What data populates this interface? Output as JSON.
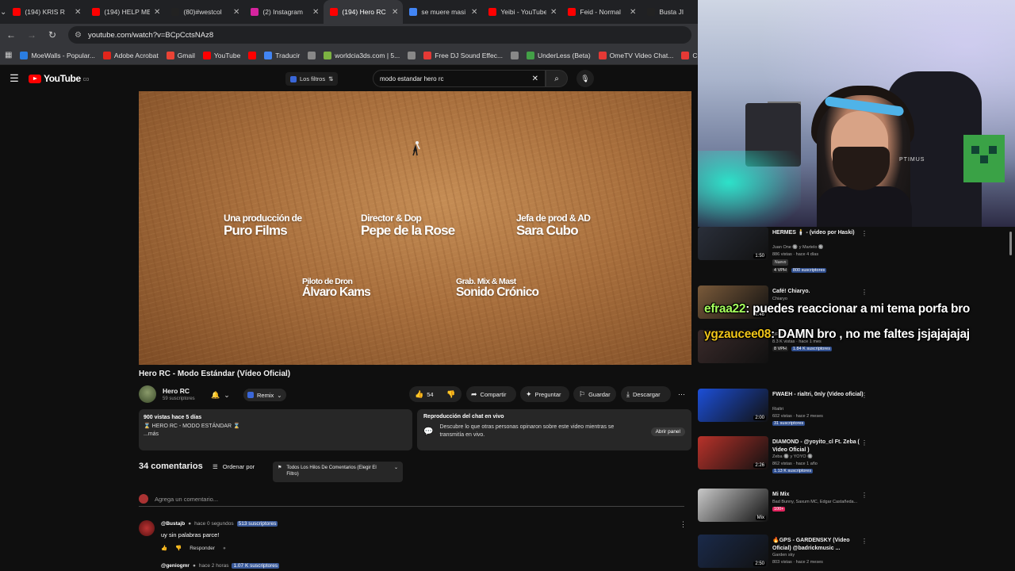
{
  "browser": {
    "tabs": [
      {
        "title": "(194) KRIS R",
        "color": "#ff0000",
        "active": false
      },
      {
        "title": "(194) HELP ME",
        "color": "#ff0000",
        "active": false
      },
      {
        "title": "(80)#westcol",
        "color": "#222222",
        "active": false
      },
      {
        "title": "(2) Instagram",
        "color": "#d6249f",
        "active": false
      },
      {
        "title": "(194) Hero RC",
        "color": "#ff0000",
        "active": true
      },
      {
        "title": "se muere masi",
        "color": "#4285f4",
        "active": false
      },
      {
        "title": "Yeibi - YouTube",
        "color": "#ff0000",
        "active": false
      },
      {
        "title": "Feid - Normal",
        "color": "#ff0000",
        "active": false
      },
      {
        "title": "Busta JI",
        "color": "#222222",
        "active": false
      }
    ],
    "url": "youtube.com/watch?v=BCpCctsNAz8",
    "bookmarks": [
      {
        "label": "MoeWalls - Popular...",
        "color": "#2a7de1"
      },
      {
        "label": "Adobe Acrobat",
        "color": "#e1251b"
      },
      {
        "label": "Gmail",
        "color": "#ea4335"
      },
      {
        "label": "YouTube",
        "color": "#ff0000"
      },
      {
        "label": "",
        "color": "#ff0000"
      },
      {
        "label": "Traducir",
        "color": "#4285f4"
      },
      {
        "label": "",
        "color": "#888888"
      },
      {
        "label": "worldcia3ds.com | 5...",
        "color": "#7cb342"
      },
      {
        "label": "",
        "color": "#888888"
      },
      {
        "label": "Free DJ Sound Effec...",
        "color": "#e53935"
      },
      {
        "label": "",
        "color": "#888888"
      },
      {
        "label": "UnderLess (Beta)",
        "color": "#43a047"
      },
      {
        "label": "OmeTV Video Chat...",
        "color": "#e53935"
      },
      {
        "label": "Ch",
        "color": "#e53935"
      }
    ]
  },
  "youtube": {
    "logo": "YouTube",
    "logo_region": "CO",
    "filters_label": "Los filtros",
    "search_query": "modo estandar hero rc"
  },
  "video": {
    "credits": [
      {
        "role": "Una producción de",
        "name": "Puro Films"
      },
      {
        "role": "Director & Dop",
        "name": "Pepe de la Rose"
      },
      {
        "role": "Jefa de prod & AD",
        "name": "Sara Cubo"
      },
      {
        "role": "Piloto de Dron",
        "name": "Álvaro Kams"
      },
      {
        "role": "Grab. Mix & Mast",
        "name": "Sonido Crónico"
      }
    ],
    "title": "Hero RC - Modo Estándar (Vídeo Oficial)",
    "channel": "Hero RC",
    "subscribers": "59 suscriptores",
    "remix": "Remix",
    "likes": "54",
    "share": "Compartir",
    "ask": "Preguntar",
    "save": "Guardar",
    "download": "Descargar"
  },
  "description": {
    "stats": "900 vistas  hace 5 días",
    "line": "⌛ HERO RC - MODO ESTÁNDAR ⌛",
    "more": "...más"
  },
  "chat_replay": {
    "title": "Reproducción del chat en vivo",
    "text": "Descubre lo que otras personas opinaron sobre este video mientras se transmitía en vivo.",
    "open": "Abrir panel"
  },
  "comments": {
    "count": "34 comentarios",
    "sort": "Ordenar por",
    "thread_filter": "Todos Los Hilos De Comentarios (Elegir El Filtro)",
    "add_placeholder": "Agrega un comentario...",
    "items": [
      {
        "user": "@Bustajb",
        "time": "hace 0 segundos",
        "subs": "513 suscriptores",
        "text": "uy sin palabras parce!",
        "reply": "Responder"
      },
      {
        "user": "@geniogmr",
        "time": "hace 2 horas",
        "subs": "1.07 K suscriptores"
      }
    ]
  },
  "recommendations": [
    {
      "title": "HERMES 🕯️ - (video por Haski)",
      "channel": "Juan One 🔘 y Martelo 🔘",
      "views": "886 vistas · hace 4 días",
      "tag": "Nuevo",
      "subs": "800 suscriptores",
      "extra": "4 VPH",
      "duration": "1:50",
      "thumb": "#2a2f3a"
    },
    {
      "title": "Café! Chiaryo.",
      "channel": "Chiaryo",
      "views": "",
      "tag": "",
      "subs": "",
      "extra": "",
      "duration": "2:46",
      "thumb": "#7a5a3a"
    },
    {
      "title": "",
      "channel": "OFICIAL)",
      "views": "8.3 K vistas · hace 1 mes",
      "tag": "",
      "subs": "1.84 K suscriptores",
      "extra": "8 VPH",
      "duration": "",
      "thumb": "#3a2a2a"
    },
    {
      "title": "FWAEH - rialtri, 0nly (Video oficial)",
      "channel": "Rialtri",
      "views": "602 vistas · hace 2 meses",
      "tag": "",
      "subs": "31 suscriptores",
      "extra": "",
      "duration": "2:00",
      "thumb": "#1c4fd8"
    },
    {
      "title": "DIAMOND - @yoyito_cl  Ft. Zeba ( Video Oficial )",
      "channel": "Zeba 🔘 y YOYO 🔘",
      "views": "862 vistas · hace 1 año",
      "tag": "",
      "subs": "1.13 K suscriptores",
      "extra": "",
      "duration": "2:26",
      "thumb": "#b8322a"
    },
    {
      "title": "Mi Mix",
      "channel": "Bad Bunny, Saxum MC, Edgar Castañeda...",
      "views": "",
      "tag": "",
      "subs": "",
      "extra": "100+",
      "duration": "Mix",
      "thumb": "#c9c9c9"
    },
    {
      "title": "🔥GPS - GARDENSKY (Video Oficial) @badrickmusic ...",
      "channel": "Garden sky",
      "views": "803 vistas · hace 2 meses",
      "tag": "",
      "subs": "",
      "extra": "",
      "duration": "2:50",
      "thumb": "#1a2a4a"
    }
  ],
  "webcam": {
    "shirt_text": "PTIMUS"
  },
  "chat_overlay": [
    {
      "user": "efraa22",
      "message": ": puedes reaccionar a mi tema porfa bro",
      "color": "#a6ff5c"
    },
    {
      "user": "ygzaucee08",
      "message": ": DAMN bro , no me faltes jsjajajajaj",
      "color": "#f0c419"
    }
  ]
}
